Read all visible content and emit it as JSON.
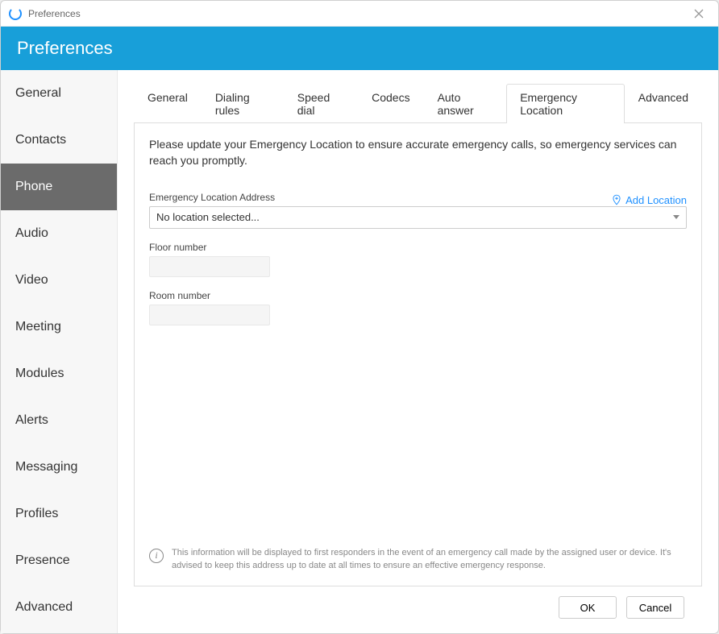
{
  "window": {
    "title": "Preferences"
  },
  "banner": {
    "title": "Preferences"
  },
  "sidebar": {
    "items": [
      {
        "label": "General",
        "active": false
      },
      {
        "label": "Contacts",
        "active": false
      },
      {
        "label": "Phone",
        "active": true
      },
      {
        "label": "Audio",
        "active": false
      },
      {
        "label": "Video",
        "active": false
      },
      {
        "label": "Meeting",
        "active": false
      },
      {
        "label": "Modules",
        "active": false
      },
      {
        "label": "Alerts",
        "active": false
      },
      {
        "label": "Messaging",
        "active": false
      },
      {
        "label": "Profiles",
        "active": false
      },
      {
        "label": "Presence",
        "active": false
      },
      {
        "label": "Advanced",
        "active": false
      }
    ]
  },
  "tabs": {
    "items": [
      {
        "label": "General",
        "active": false
      },
      {
        "label": "Dialing rules",
        "active": false
      },
      {
        "label": "Speed dial",
        "active": false
      },
      {
        "label": "Codecs",
        "active": false
      },
      {
        "label": "Auto answer",
        "active": false
      },
      {
        "label": "Emergency Location",
        "active": true
      },
      {
        "label": "Advanced",
        "active": false
      }
    ]
  },
  "page": {
    "description": "Please update your Emergency Location to ensure accurate emergency calls, so emergency services can reach you promptly.",
    "address_label": "Emergency Location Address",
    "add_link": "Add Location",
    "address_value": "No location selected...",
    "floor_label": "Floor number",
    "floor_value": "",
    "room_label": "Room number",
    "room_value": "",
    "info_text": "This information will be displayed to first responders in the event of an emergency call made by the assigned user or device. It's advised to keep this address up to date at all times to ensure an effective emergency response."
  },
  "footer": {
    "ok": "OK",
    "cancel": "Cancel"
  }
}
